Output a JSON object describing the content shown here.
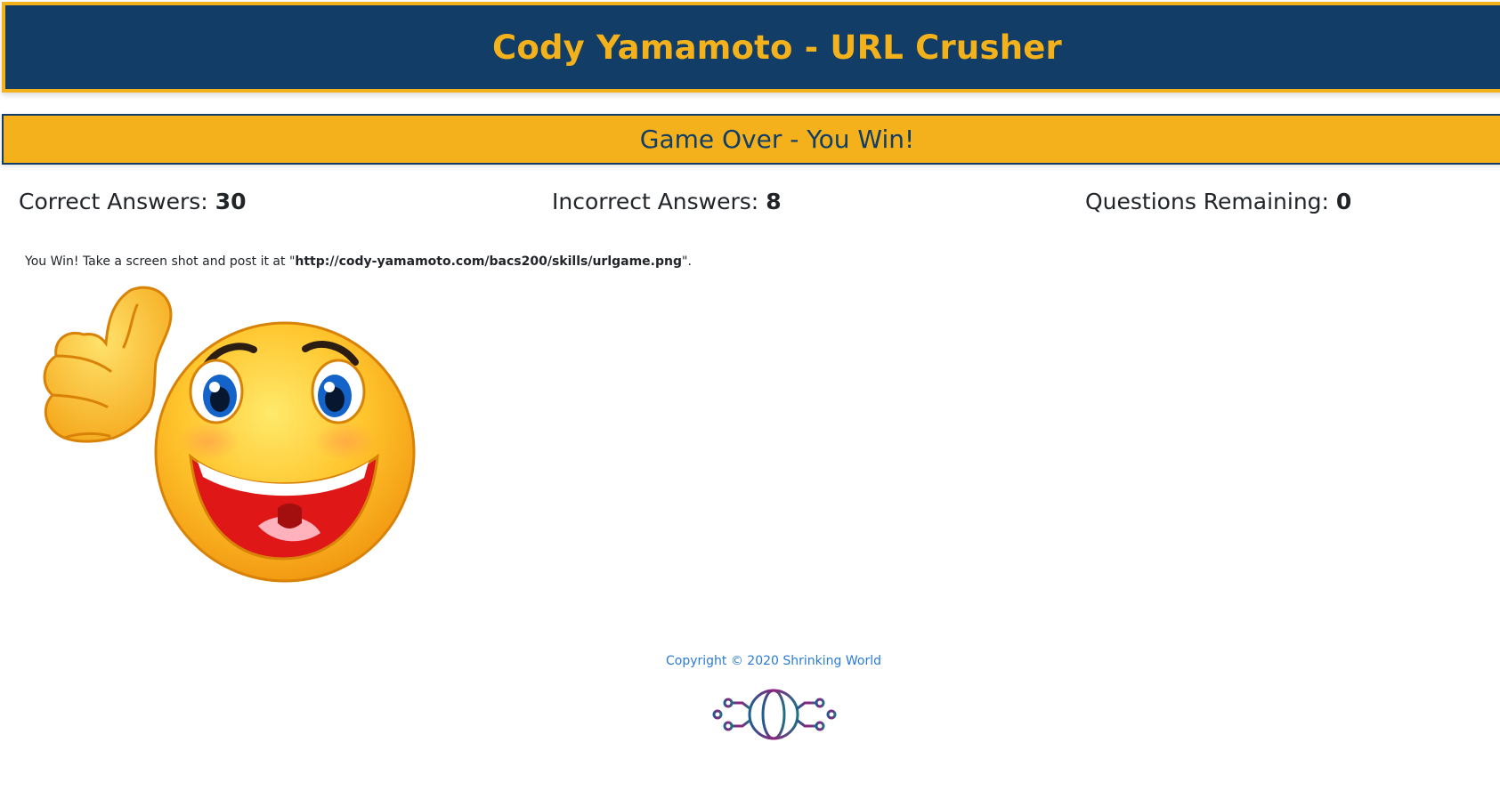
{
  "header": {
    "title": "Cody Yamamoto - URL Crusher"
  },
  "status": {
    "text": "Game Over - You Win!"
  },
  "scores": {
    "correct_label": "Correct Answers:",
    "correct_value": "30",
    "incorrect_label": "Incorrect Answers:",
    "incorrect_value": "8",
    "remaining_label": "Questions Remaining:",
    "remaining_value": "0"
  },
  "message": {
    "prefix": "You Win! Take a screen shot and post it at \"",
    "url": "http://cody-yamamoto.com/bacs200/skills/urlgame.png",
    "suffix": "\"."
  },
  "image": {
    "icon": "thumbs-up-smiley-icon"
  },
  "footer": {
    "copyright": "Copyright © 2020 Shrinking World",
    "logo_icon": "globe-circuit-logo-icon"
  },
  "colors": {
    "header_bg": "#123d66",
    "accent": "#f3b11b",
    "link": "#2b7bd6"
  }
}
